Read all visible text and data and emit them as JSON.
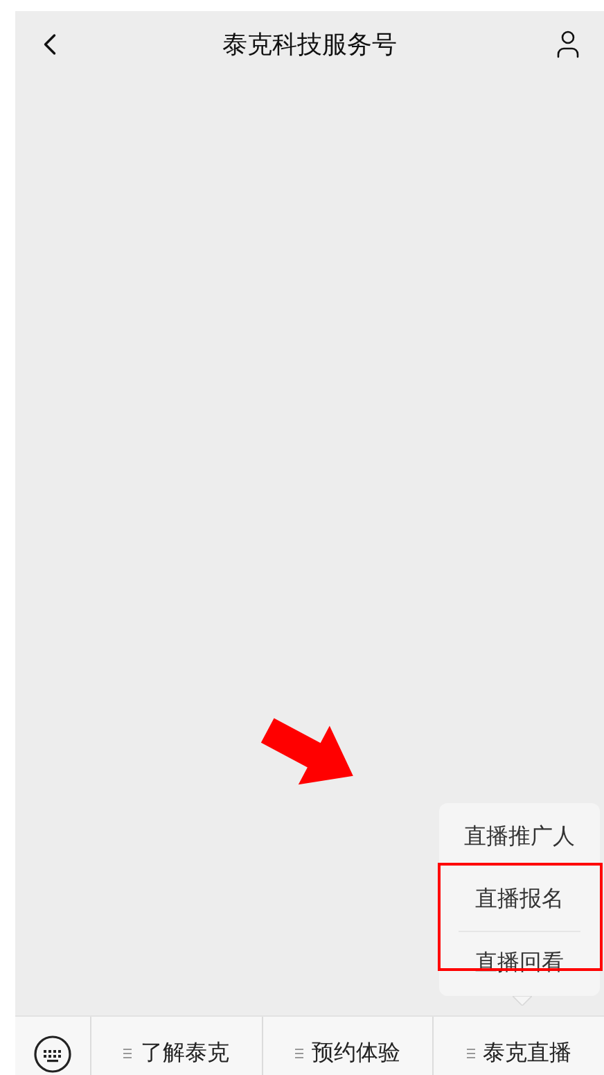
{
  "header": {
    "title": "泰克科技服务号"
  },
  "menu": [
    {
      "label": "了解泰克"
    },
    {
      "label": "预约体验"
    },
    {
      "label": "泰克直播"
    }
  ],
  "popup": {
    "items": [
      {
        "label": "直播推广人"
      },
      {
        "label": "直播报名"
      },
      {
        "label": "直播回看"
      }
    ]
  }
}
